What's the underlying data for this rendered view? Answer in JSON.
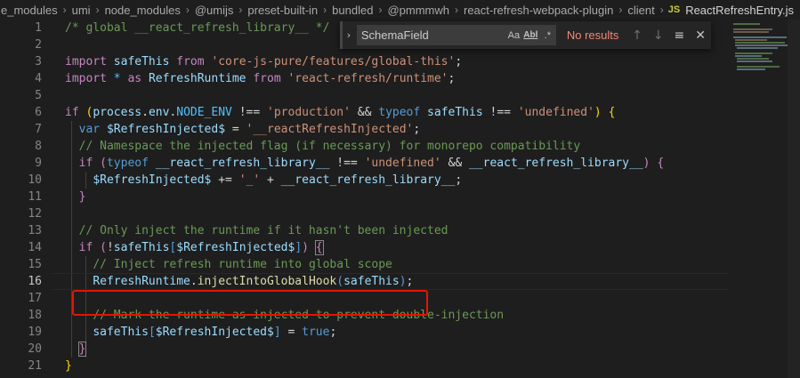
{
  "breadcrumb": {
    "items": [
      "e_modules",
      "umi",
      "node_modules",
      "@umijs",
      "preset-built-in",
      "bundled",
      "@pmmmwh",
      "react-refresh-webpack-plugin",
      "client"
    ],
    "file_icon": "JS",
    "file_name": "ReactRefreshEntry.js",
    "separator": "›"
  },
  "find": {
    "query": "SchemaField",
    "match_case": "Aa",
    "whole_word": "Abl",
    "regex": ".*",
    "result": "No results",
    "prev": "↑",
    "next": "↓",
    "selection": "≡",
    "close": "✕",
    "toggle": "›"
  },
  "editor": {
    "line_numbers": [
      "1",
      "2",
      "3",
      "4",
      "5",
      "6",
      "7",
      "8",
      "9",
      "10",
      "11",
      "12",
      "13",
      "14",
      "15",
      "16",
      "17",
      "18",
      "19",
      "20",
      "21"
    ],
    "current_line": "16"
  },
  "colors": {
    "background": "#1e1e1e",
    "highlight_box": "#e51400",
    "keyword": "#569cd6",
    "string": "#ce9178",
    "comment": "#6a9955"
  }
}
